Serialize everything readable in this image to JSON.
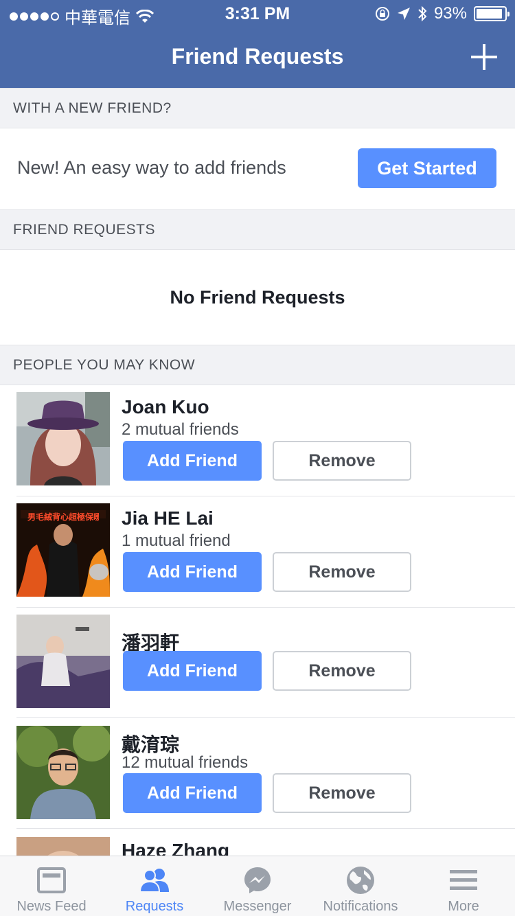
{
  "status_bar": {
    "carrier": "中華電信",
    "time": "3:31 PM",
    "battery": "93%",
    "battery_level": 0.93
  },
  "nav": {
    "title": "Friend Requests",
    "add_icon": "plus-icon"
  },
  "colors": {
    "nav_bg": "#4a6aa9",
    "primary_button": "#5890ff",
    "active_tab": "#4e86f6"
  },
  "section_new_friend": {
    "title": "WITH A NEW FRIEND?"
  },
  "promo": {
    "text": "New! An easy way to add friends",
    "button": "Get Started"
  },
  "section_requests": {
    "title": "FRIEND REQUESTS",
    "empty_text": "No Friend Requests"
  },
  "section_people": {
    "title": "PEOPLE YOU MAY KNOW"
  },
  "people": [
    {
      "name": "Joan Kuo",
      "mutual": "2 mutual friends",
      "add": "Add Friend",
      "remove": "Remove"
    },
    {
      "name": "Jia HE Lai",
      "mutual": "1 mutual friend",
      "add": "Add Friend",
      "remove": "Remove",
      "photo_caption": "男毛絨背心超極保暖"
    },
    {
      "name": "潘羽軒",
      "mutual": "",
      "add": "Add Friend",
      "remove": "Remove"
    },
    {
      "name": "戴淯琮",
      "mutual": "12 mutual friends",
      "add": "Add Friend",
      "remove": "Remove"
    },
    {
      "name": "Haze Zhang"
    }
  ],
  "tabs": [
    {
      "label": "News Feed",
      "icon": "news-feed-icon"
    },
    {
      "label": "Requests",
      "icon": "requests-icon",
      "active": true
    },
    {
      "label": "Messenger",
      "icon": "messenger-icon"
    },
    {
      "label": "Notifications",
      "icon": "globe-icon"
    },
    {
      "label": "More",
      "icon": "menu-icon"
    }
  ]
}
